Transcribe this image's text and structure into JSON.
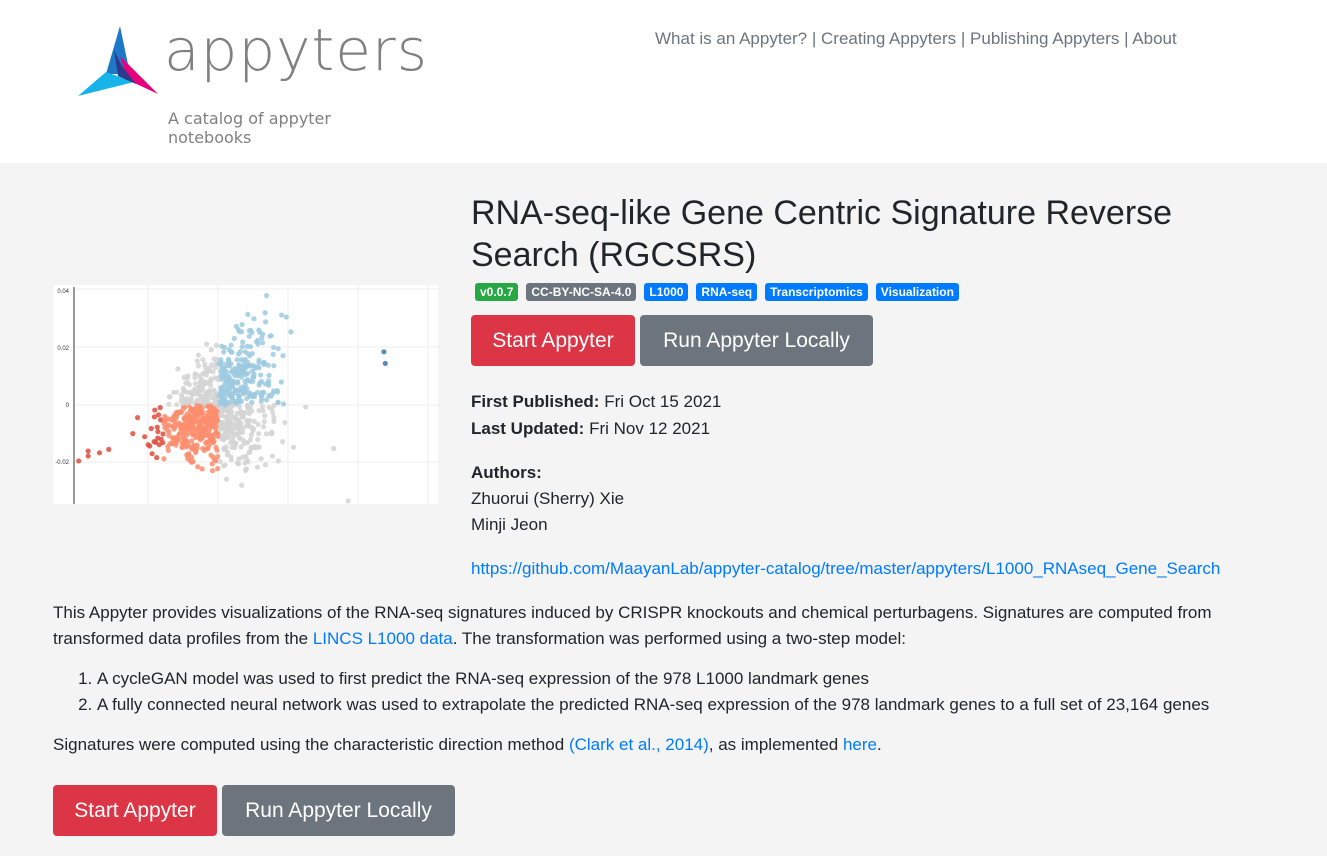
{
  "header": {
    "logo_text": "appyters",
    "logo_tagline": "A catalog of appyter notebooks",
    "nav": [
      "What is an Appyter?",
      "Creating Appyters",
      "Publishing Appyters",
      "About"
    ],
    "nav_separator": " | "
  },
  "thumbnail": {
    "y_ticks": [
      "0.04",
      "0.02",
      "0",
      "-0.02"
    ]
  },
  "appyter": {
    "title": "RNA-seq-like Gene Centric Signature Reverse Search (RGCSRS)",
    "badges": [
      {
        "label": "v0.0.7",
        "color": "#28a745"
      },
      {
        "label": "CC-BY-NC-SA-4.0",
        "color": "#6c757d"
      },
      {
        "label": "L1000",
        "color": "#007bff"
      },
      {
        "label": "RNA-seq",
        "color": "#007bff"
      },
      {
        "label": "Transcriptomics",
        "color": "#007bff"
      },
      {
        "label": "Visualization",
        "color": "#007bff"
      }
    ],
    "start_label": "Start Appyter",
    "run_local_label": "Run Appyter Locally",
    "first_published_label": "First Published:",
    "first_published": "Fri Oct 15 2021",
    "last_updated_label": "Last Updated:",
    "last_updated": "Fri Nov 12 2021",
    "authors_label": "Authors:",
    "authors": [
      "Zhuorui (Sherry) Xie",
      "Minji Jeon"
    ],
    "repo_url": "https://github.com/MaayanLab/appyter-catalog/tree/master/appyters/L1000_RNAseq_Gene_Search"
  },
  "description": {
    "p1_a": "This Appyter provides visualizations of the RNA-seq signatures induced by CRISPR knockouts and chemical perturbagens. Signatures are computed from transformed data profiles from the ",
    "p1_link": "LINCS L1000 data",
    "p1_b": ". The transformation was performed using a two-step model:",
    "steps": [
      "A cycleGAN model was used to first predict the RNA-seq expression of the 978 L1000 landmark genes",
      "A fully connected neural network was used to extrapolate the predicted RNA-seq expression of the 978 landmark genes to a full set of 23,164 genes"
    ],
    "p2_a": "Signatures were computed using the characteristic direction method ",
    "p2_link1": "(Clark et al., 2014)",
    "p2_b": ", as implemented ",
    "p2_link2": "here",
    "p2_c": "."
  },
  "colors": {
    "accent": "#dc3545",
    "secondary": "#6c757d",
    "link": "#007bff"
  }
}
